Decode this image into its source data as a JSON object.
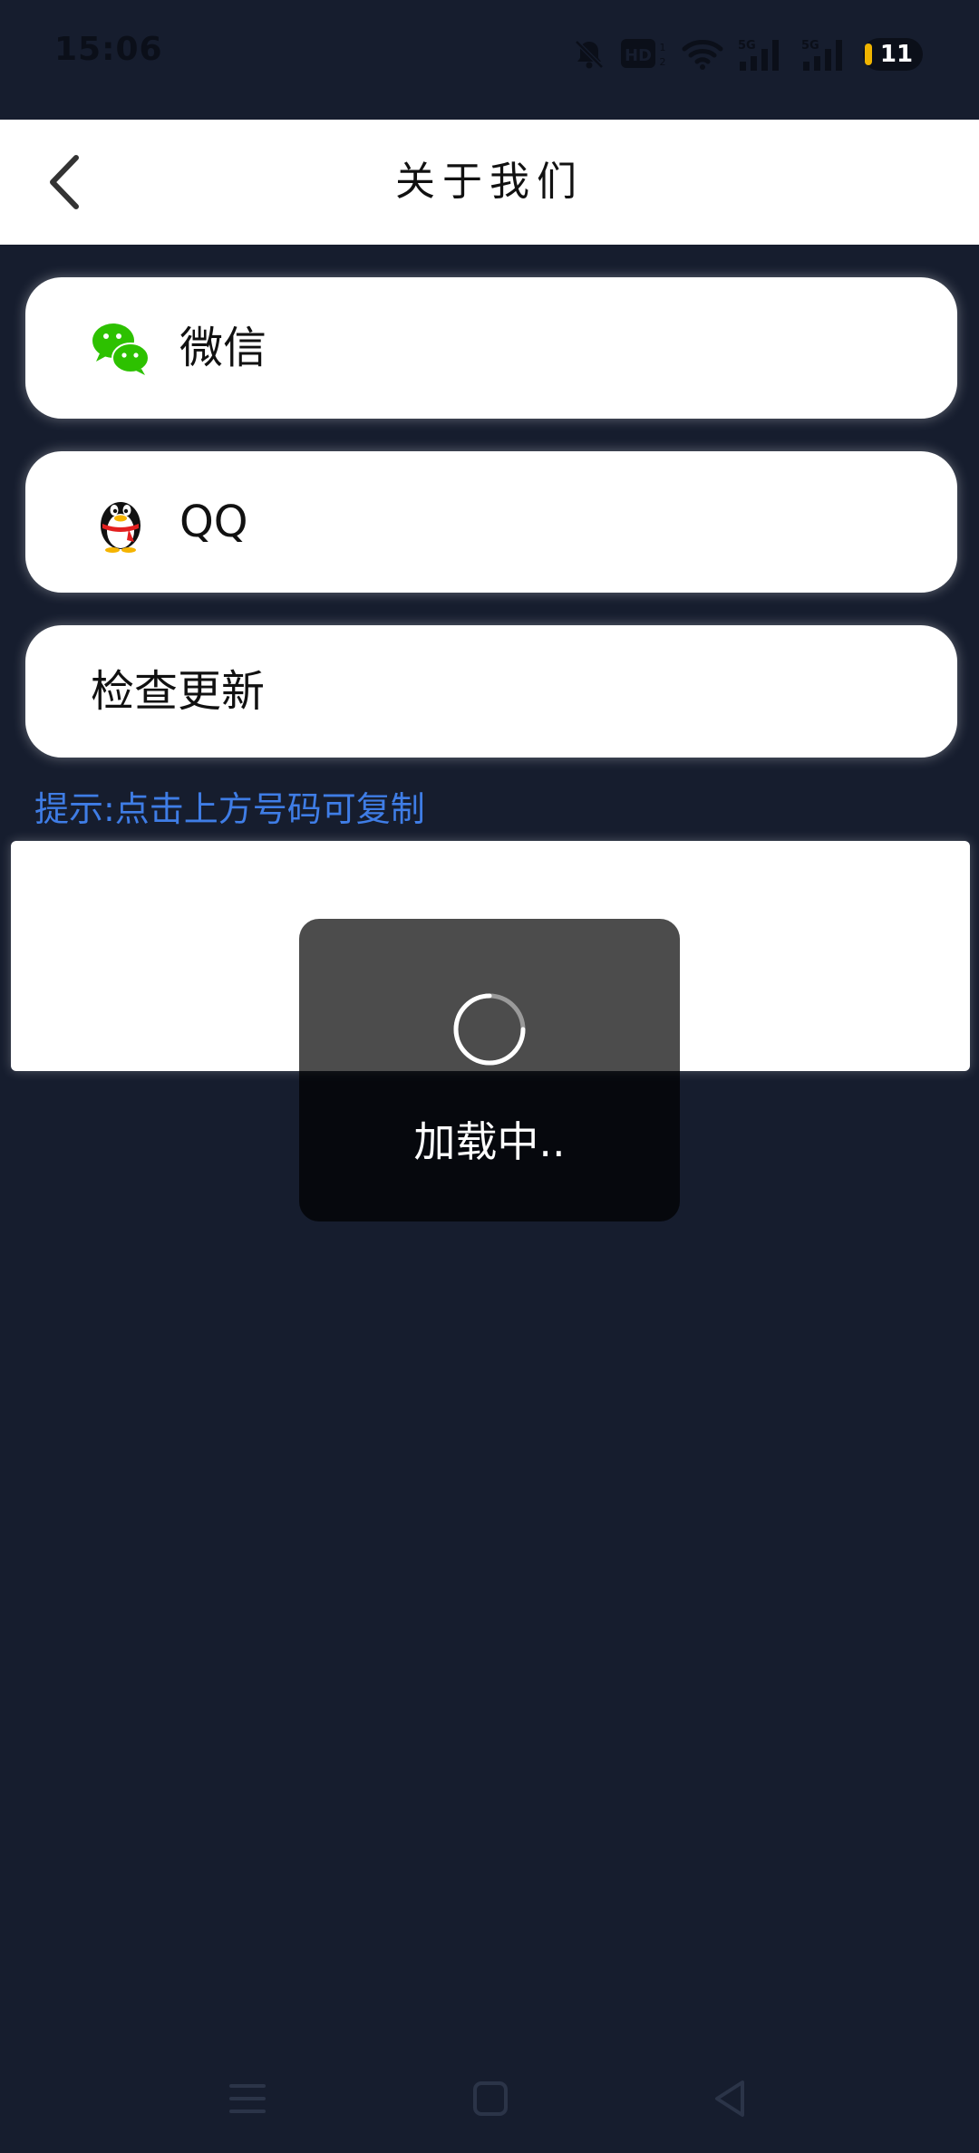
{
  "status_bar": {
    "time": "15:06",
    "battery_level": "11",
    "icons": [
      "mute-bell-icon",
      "hd-icon",
      "wifi-icon",
      "signal-5g-icon",
      "signal-5g-icon",
      "battery-icon"
    ],
    "hd_label": "HD",
    "network_label_1": "5G",
    "network_label_2": "5G"
  },
  "header": {
    "title": "关于我们",
    "back_icon": "chevron-left-icon"
  },
  "items": [
    {
      "label": "微信",
      "icon": "wechat-icon",
      "icon_color": "#2dc100"
    },
    {
      "label": "QQ",
      "icon": "qq-penguin-icon"
    },
    {
      "label": "检查更新"
    }
  ],
  "hint": "提示:点击上方号码可复制",
  "loading": {
    "text": "加载中..",
    "icon": "spinner-icon"
  },
  "nav": {
    "icons": [
      "menu-icon",
      "home-icon",
      "back-triangle-icon"
    ]
  },
  "colors": {
    "background": "#161d2e",
    "hint": "#3f7de6",
    "battery_accent": "#f0b400",
    "wechat_green": "#2dc100"
  }
}
